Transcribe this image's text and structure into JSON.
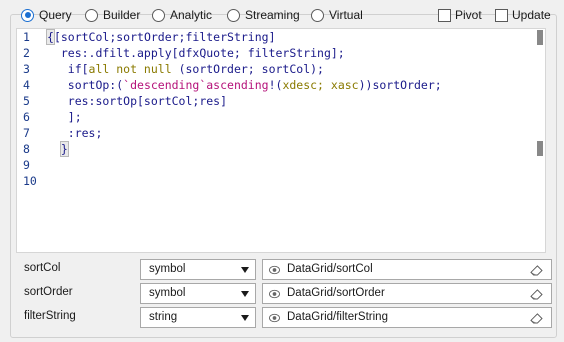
{
  "mode_tabs": [
    {
      "label": "Query",
      "selected": true
    },
    {
      "label": "Builder",
      "selected": false
    },
    {
      "label": "Analytic",
      "selected": false
    },
    {
      "label": "Streaming",
      "selected": false
    },
    {
      "label": "Virtual",
      "selected": false
    }
  ],
  "options": {
    "pivot_label": "Pivot",
    "update_label": "Update"
  },
  "editor": {
    "line_numbers": [
      "1",
      "2",
      "3",
      "4",
      "5",
      "6",
      "7",
      "8",
      "9",
      "10"
    ]
  },
  "code_lines": {
    "l1_open": "{",
    "l1_rest": "[sortCol;sortOrder;filterString]",
    "l2": "  res:.dfilt.apply[dfxQuote; filterString];",
    "l3_a": "   if[",
    "l3_b": "all not null",
    "l3_c": " (sortOrder; sortCol);",
    "l4_a": "   sortOp:(",
    "l4_b": "`descending`ascending",
    "l4_c": "!(",
    "l4_d": "xdesc; xasc",
    "l4_e": "))sortOrder;",
    "l5": "   res:sortOp[sortCol;res]",
    "l6": "   ];",
    "l7": "   :res;",
    "l8_pre": "  ",
    "l8_close": "}"
  },
  "params": [
    {
      "name": "sortCol",
      "type": "symbol",
      "value": "DataGrid/sortCol"
    },
    {
      "name": "sortOrder",
      "type": "symbol",
      "value": "DataGrid/sortOrder"
    },
    {
      "name": "filterString",
      "type": "string",
      "value": "DataGrid/filterString"
    }
  ],
  "colors": {
    "accent": "#1b6fd2",
    "keyword": "#1a1a8a",
    "symbol_literal": "#b5127a",
    "function_name": "#8a7a00"
  }
}
